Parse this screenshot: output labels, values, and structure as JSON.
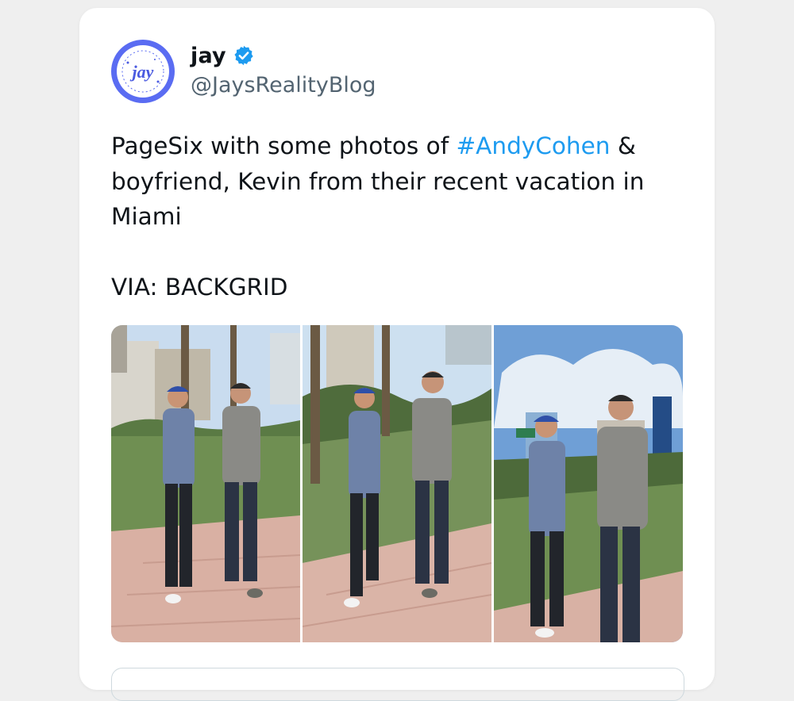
{
  "tweet": {
    "display_name": "jay",
    "handle": "@JaysRealityBlog",
    "avatar_text": "jay",
    "text_before": "PageSix with some photos of ",
    "hashtag": "#AndyCohen",
    "text_after": " & boyfriend, Kevin from their recent vacation in Miami\n\nVIA: BACKGRID"
  },
  "media": {
    "photos": [
      {
        "name": "photo-1"
      },
      {
        "name": "photo-2"
      },
      {
        "name": "photo-3"
      }
    ]
  },
  "colors": {
    "accent": "#1d9bf0",
    "avatar_ring": "#5a6cf2",
    "handle_gray": "#536471"
  }
}
